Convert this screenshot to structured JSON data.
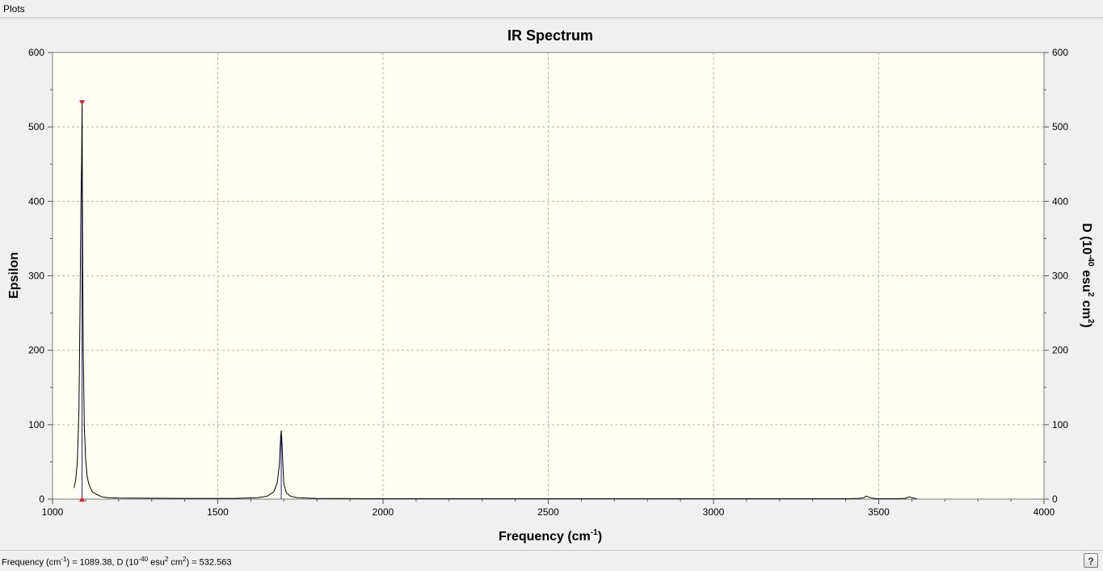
{
  "menubar": {
    "plots_label": "Plots"
  },
  "status": {
    "freq_label": "Frequency (cm",
    "freq_exp": "-1",
    "mid_text": ") = 1089.38, D (10",
    "d_exp": "-40",
    "esu_text": " esu",
    "esu_exp": "2",
    "cm_text": " cm",
    "cm_exp": "2",
    "value_text": ") = 532.563"
  },
  "help_button": {
    "label": "?"
  },
  "chart_data": {
    "type": "line",
    "title": "IR Spectrum",
    "xlabel": "Frequency (cm-1)",
    "ylabel": "Epsilon",
    "y2label": "D (10-40 esu2 cm2)",
    "xlim": [
      1000,
      4000
    ],
    "ylim": [
      0,
      600
    ],
    "y2lim": [
      0,
      600
    ],
    "x_ticks": [
      "1000",
      "1500",
      "2000",
      "2500",
      "3000",
      "3500",
      "4000"
    ],
    "y_ticks": [
      "0",
      "100",
      "200",
      "300",
      "400",
      "500",
      "600"
    ],
    "y2_ticks": [
      "0",
      "100",
      "200",
      "300",
      "400",
      "500",
      "600"
    ],
    "grid": true,
    "colors": {
      "plot_bg": "#fffff3",
      "grid": "#b4b4b4",
      "spectrum": "#000000",
      "stick": "#1a1aa8",
      "marker": "#e02020"
    },
    "series": [
      {
        "name": "Epsilon",
        "x": [
          1065,
          1070,
          1075,
          1080,
          1083,
          1086,
          1088,
          1089.38,
          1091,
          1093,
          1096,
          1100,
          1105,
          1110,
          1120,
          1135,
          1150,
          1170,
          1200,
          1400,
          1550,
          1620,
          1650,
          1670,
          1680,
          1686,
          1690,
          1692,
          1694,
          1697,
          1700,
          1708,
          1720,
          1740,
          1800,
          2000,
          2600,
          3000,
          3400,
          3440,
          3455,
          3462,
          3468,
          3475,
          3490,
          3550,
          3580,
          3592,
          3600,
          3608,
          3615
        ],
        "y": [
          15,
          25,
          50,
          120,
          240,
          400,
          455,
          532.563,
          330,
          200,
          100,
          55,
          30,
          20,
          10,
          6,
          3,
          2,
          1.5,
          1,
          1,
          2,
          4,
          10,
          22,
          45,
          80,
          92,
          80,
          45,
          20,
          8,
          4,
          2,
          1,
          0.5,
          0.5,
          0.5,
          0.5,
          1,
          2,
          4,
          3,
          2,
          0.5,
          0.5,
          1,
          3,
          2,
          1,
          0
        ]
      }
    ],
    "sticks": [
      {
        "x": 1089.38,
        "y": 532.563
      },
      {
        "x": 1692,
        "y": 92
      }
    ],
    "selected": {
      "x": 1089.38,
      "y": 532.563
    }
  }
}
